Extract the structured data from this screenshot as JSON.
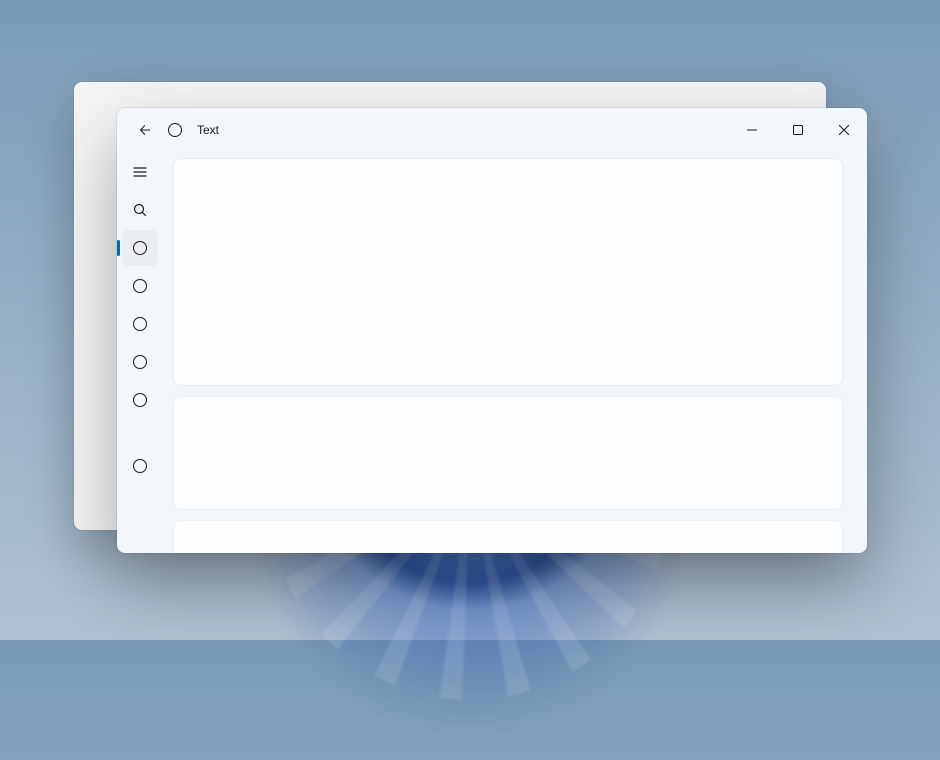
{
  "titlebar": {
    "title": "Text"
  },
  "nav": {
    "items": [
      {
        "id": "nav-1",
        "selected": false
      },
      {
        "id": "nav-2",
        "selected": true
      },
      {
        "id": "nav-3",
        "selected": false
      },
      {
        "id": "nav-4",
        "selected": false
      },
      {
        "id": "nav-5",
        "selected": false
      },
      {
        "id": "nav-6",
        "selected": false
      },
      {
        "id": "nav-7",
        "selected": false
      }
    ]
  }
}
